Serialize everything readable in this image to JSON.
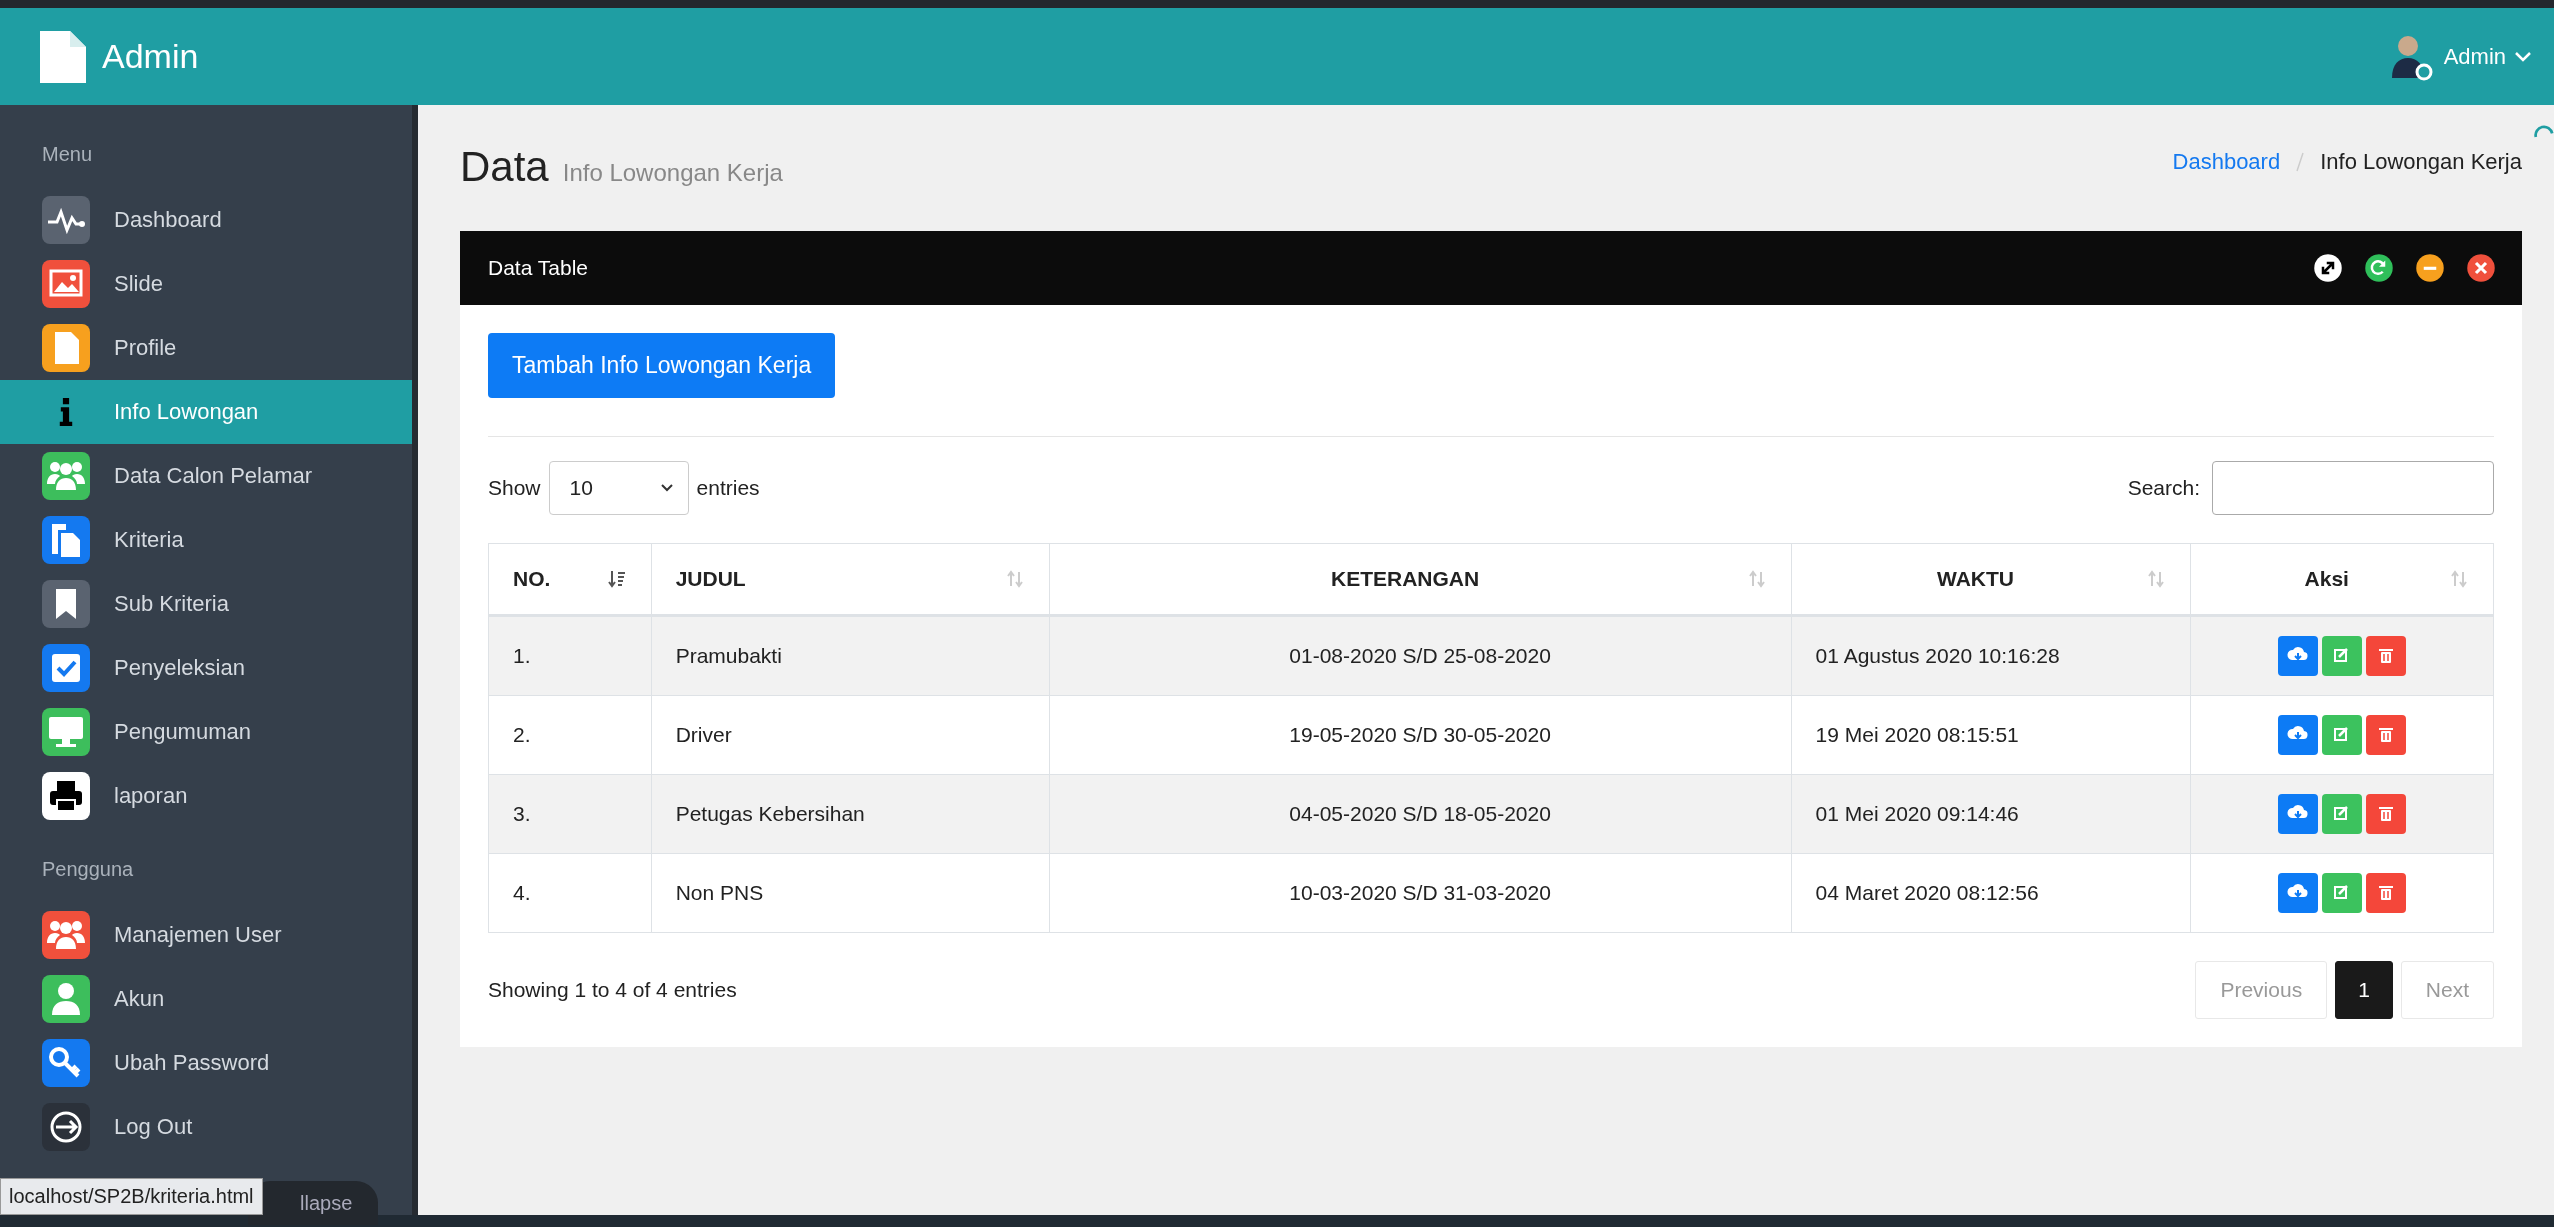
{
  "top_bar": {
    "brand": "Admin",
    "user": "Admin"
  },
  "sidebar": {
    "sections": [
      {
        "heading": "Menu",
        "items": [
          {
            "label": "Dashboard",
            "kind": "pulse",
            "color": "#5a6370",
            "selected": false
          },
          {
            "label": "Slide",
            "kind": "image",
            "color": "#f0503c",
            "selected": false
          },
          {
            "label": "Profile",
            "kind": "file",
            "color": "#f7a01e",
            "selected": false
          },
          {
            "label": "Info Lowongan",
            "kind": "info",
            "selected": true
          },
          {
            "label": "Data Calon Pelamar",
            "kind": "group",
            "color": "#3dbe5c",
            "selected": false
          },
          {
            "label": "Kriteria",
            "kind": "copy",
            "color": "#1479f0",
            "selected": false
          },
          {
            "label": "Sub Kriteria",
            "kind": "bookmark",
            "color": "#5a6370",
            "selected": false
          },
          {
            "label": "Penyeleksian",
            "kind": "check",
            "color": "#1479f0",
            "selected": false
          },
          {
            "label": "Pengumuman",
            "kind": "monitor",
            "color": "#3dbe5c",
            "selected": false
          },
          {
            "label": "laporan",
            "kind": "print",
            "color": "#ffffff",
            "selected": false
          }
        ]
      },
      {
        "heading": "Pengguna",
        "items": [
          {
            "label": "Manajemen User",
            "kind": "group",
            "color": "#f0503c",
            "selected": false
          },
          {
            "label": "Akun",
            "kind": "user",
            "color": "#3dbe5c",
            "selected": false
          },
          {
            "label": "Ubah Password",
            "kind": "key",
            "color": "#1479f0",
            "selected": false
          },
          {
            "label": "Log Out",
            "kind": "logout",
            "color": "#2b313a",
            "selected": false
          }
        ]
      }
    ],
    "collapse_button": "llapse"
  },
  "page_header": {
    "title": "Data",
    "subtitle": "Info Lowongan Kerja",
    "breadcrumb": [
      {
        "label": "Dashboard",
        "selected": false
      },
      {
        "label": "Info Lowongan Kerja",
        "selected": true
      }
    ]
  },
  "card": {
    "title": "Data Table",
    "tools": [
      {
        "kind": "expand",
        "color": "#ffffff"
      },
      {
        "kind": "refresh",
        "color": "#2fbf5a"
      },
      {
        "kind": "minimize",
        "color": "#f7a01e"
      },
      {
        "kind": "close",
        "color": "#f0503c"
      }
    ],
    "add_button": "Tambah Info Lowongan Kerja",
    "length": {
      "label_before": "Show",
      "value": "10",
      "label_after": "entries"
    },
    "search": {
      "label": "Search:"
    },
    "table": {
      "columns": [
        {
          "label": "NO.",
          "sorted": true
        },
        {
          "label": "JUDUL",
          "sorted": false
        },
        {
          "label": "KETERANGAN",
          "sorted": false
        },
        {
          "label": "WAKTU",
          "sorted": false
        },
        {
          "label": "Aksi",
          "sorted": false
        }
      ],
      "rows": [
        {
          "cells": [
            "1.",
            "Pramubakti",
            "01-08-2020 S/D 25-08-2020",
            "01 Agustus 2020 10:16:28"
          ]
        },
        {
          "cells": [
            "2.",
            "Driver",
            "19-05-2020 S/D 30-05-2020",
            "19 Mei 2020 08:15:51"
          ]
        },
        {
          "cells": [
            "3.",
            "Petugas Kebersihan",
            "04-05-2020 S/D 18-05-2020",
            "01 Mei 2020 09:14:46"
          ]
        },
        {
          "cells": [
            "4.",
            "Non PNS",
            "10-03-2020 S/D 31-03-2020",
            "04 Maret 2020 08:12:56"
          ]
        }
      ],
      "row_actions": [
        {
          "kind": "download",
          "color": "#0d7bf5"
        },
        {
          "kind": "edit",
          "color": "#3cc25e"
        },
        {
          "kind": "delete",
          "color": "#f4473a"
        }
      ]
    },
    "info": "Showing 1 to 4 of 4 entries",
    "pagination": [
      {
        "label": "Previous",
        "selected": false,
        "disabled": true
      },
      {
        "label": "1",
        "selected": true,
        "disabled": false
      },
      {
        "label": "Next",
        "selected": false,
        "disabled": true
      }
    ]
  },
  "status_url": "localhost/SP2B/kriteria.html"
}
